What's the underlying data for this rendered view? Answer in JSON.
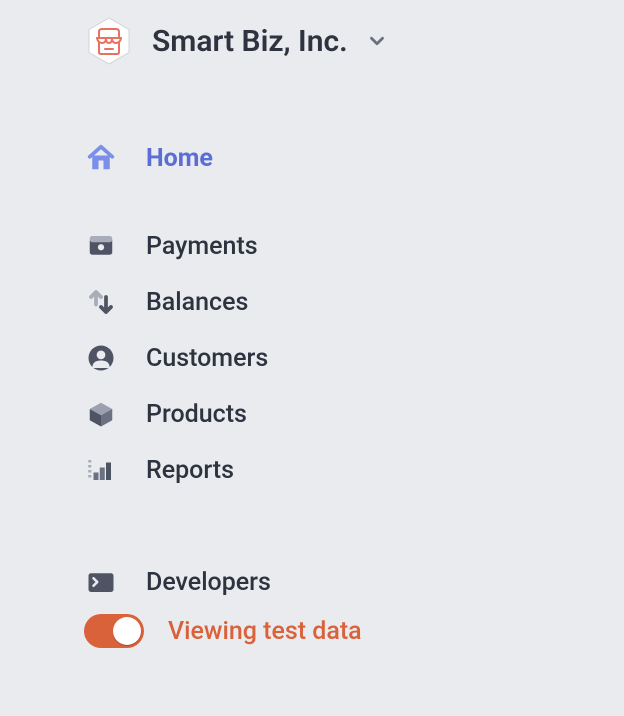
{
  "org": {
    "name": "Smart Biz, Inc."
  },
  "nav": {
    "home": {
      "label": "Home",
      "active": true
    },
    "payments": {
      "label": "Payments",
      "active": false
    },
    "balances": {
      "label": "Balances",
      "active": false
    },
    "customers": {
      "label": "Customers",
      "active": false
    },
    "products": {
      "label": "Products",
      "active": false
    },
    "reports": {
      "label": "Reports",
      "active": false
    },
    "developers": {
      "label": "Developers",
      "active": false
    }
  },
  "test_mode": {
    "label": "Viewing test data",
    "on": true
  }
}
